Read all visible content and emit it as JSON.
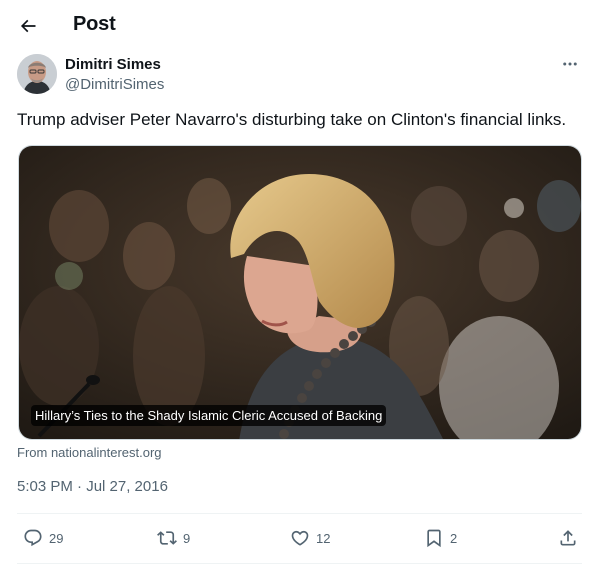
{
  "header": {
    "title": "Post"
  },
  "author": {
    "name": "Dimitri Simes",
    "handle": "@DimitriSimes"
  },
  "post": {
    "text": "Trump adviser Peter Navarro's disturbing take on Clinton's financial links.",
    "media_caption": "Hillary’s Ties to the Shady Islamic Cleric Accused of Backing",
    "source": "From nationalinterest.org",
    "timestamp": "5:03 PM · Jul 27, 2016"
  },
  "actions": {
    "replies": "29",
    "reposts": "9",
    "likes": "12",
    "bookmarks": "2"
  },
  "icons": [
    "back-arrow-icon",
    "more-icon",
    "reply-icon",
    "repost-icon",
    "like-icon",
    "bookmark-icon",
    "share-icon"
  ]
}
